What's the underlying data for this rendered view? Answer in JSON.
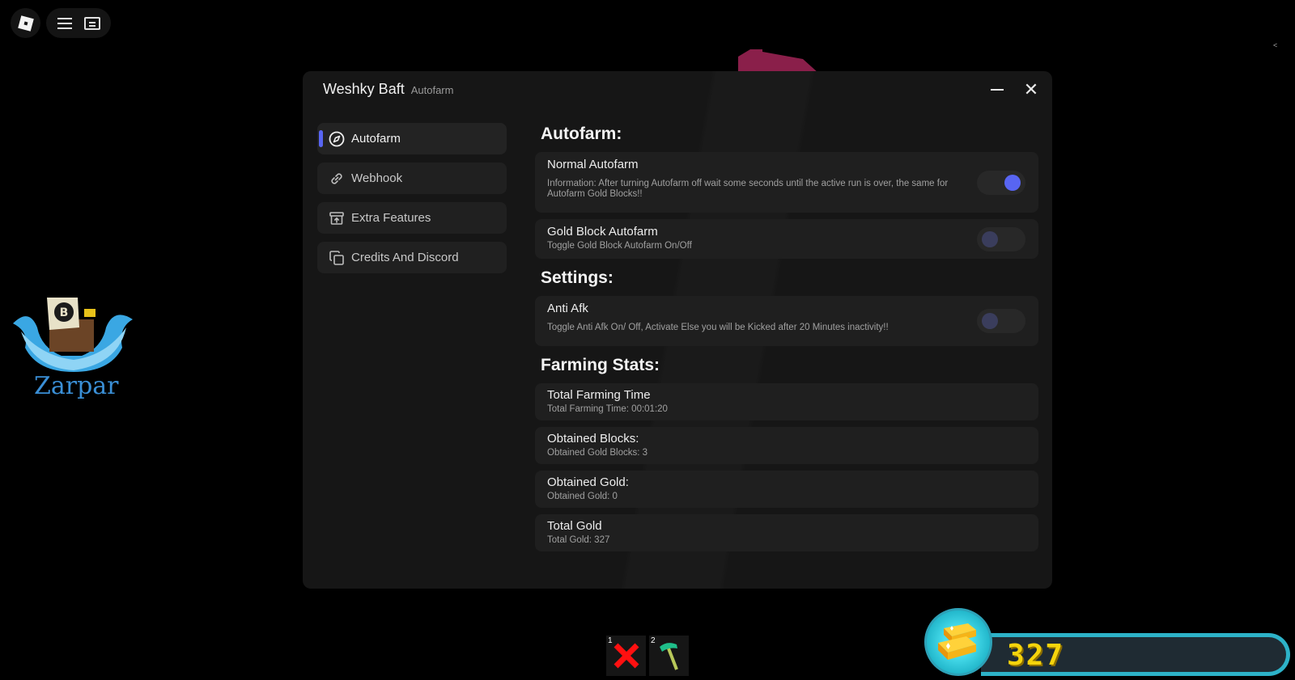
{
  "topbar": {
    "roblox_icon": "roblox-logo-icon",
    "menu_icon": "hamburger-menu-icon",
    "chat_icon": "chat-icon",
    "right_caret": "<"
  },
  "window": {
    "title": "Weshky Baft",
    "subtitle": "Autofarm",
    "minimize_icon": "minimize-icon",
    "close_icon": "✕"
  },
  "sidebar": {
    "items": [
      {
        "label": "Autofarm",
        "icon": "compass-icon",
        "active": true
      },
      {
        "label": "Webhook",
        "icon": "link-icon",
        "active": false
      },
      {
        "label": "Extra Features",
        "icon": "archive-upload-icon",
        "active": false
      },
      {
        "label": "Credits And Discord",
        "icon": "copy-icon",
        "active": false
      }
    ]
  },
  "content": {
    "autofarm_section": "Autofarm:",
    "normal_autofarm": {
      "title": "Normal Autofarm",
      "desc": "Information: After turning Autofarm off wait some seconds until the active run is over, the same for Autofarm Gold Blocks!!",
      "enabled": true
    },
    "gold_block_autofarm": {
      "title": "Gold Block Autofarm",
      "desc": "Toggle Gold Block Autofarm On/Off",
      "enabled": false
    },
    "settings_section": "Settings:",
    "anti_afk": {
      "title": "Anti Afk",
      "desc": "Toggle Anti Afk On/ Off, Activate Else you will be Kicked after 20 Minutes inactivity!!",
      "enabled": false
    },
    "stats_section": "Farming Stats:",
    "stats": [
      {
        "title": "Total Farming Time",
        "desc": "Total Farming Time: 00:01:20"
      },
      {
        "title": "Obtained Blocks:",
        "desc": "Obtained Gold Blocks: 3"
      },
      {
        "title": "Obtained Gold:",
        "desc": "Obtained Gold: 0"
      },
      {
        "title": "Total Gold",
        "desc": "Total Gold: 327"
      }
    ]
  },
  "game_logo": {
    "text": "Zarpar"
  },
  "hotbar": {
    "slots": [
      {
        "number": "1",
        "item": "red-x-icon"
      },
      {
        "number": "2",
        "item": "hammer-icon"
      }
    ]
  },
  "gold_counter": {
    "value": "327",
    "icon": "gold-bars-icon"
  },
  "colors": {
    "accent": "#5865f2",
    "window_bg": "#161616",
    "card_bg": "#1f1f1f",
    "gold": "#f5d40c",
    "cyan": "#2db2c8"
  }
}
